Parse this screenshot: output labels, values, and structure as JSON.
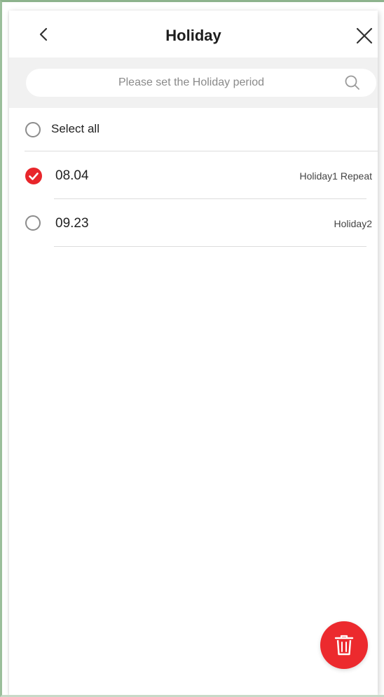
{
  "header": {
    "title": "Holiday",
    "back_icon": "chevron-left-icon",
    "close_icon": "close-icon"
  },
  "search": {
    "placeholder": "Please set the Holiday period",
    "icon": "search-icon"
  },
  "select_all": {
    "label": "Select all",
    "checked": false
  },
  "holidays": [
    {
      "date": "08.04",
      "description": "Holiday1 Repeat",
      "checked": true
    },
    {
      "date": "09.23",
      "description": "Holiday2",
      "checked": false
    }
  ],
  "fab": {
    "icon": "trash-icon"
  },
  "colors": {
    "accent": "#e8262b",
    "search_background": "#f1f1f1",
    "divider": "#dcdcdc"
  }
}
